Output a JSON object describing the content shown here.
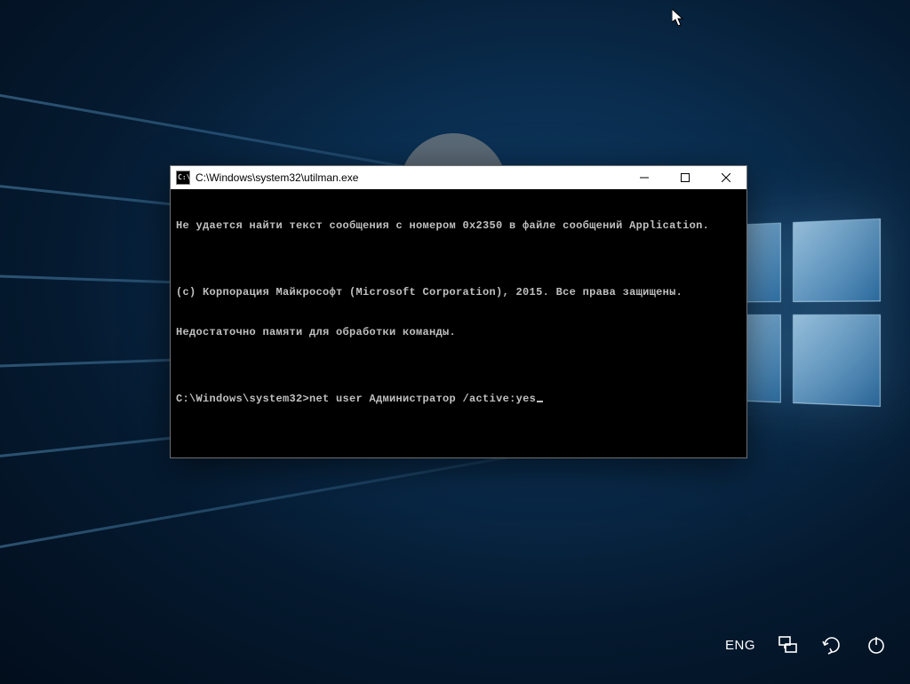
{
  "window": {
    "title": "C:\\Windows\\system32\\utilman.exe"
  },
  "terminal": {
    "lines": [
      "Не удается найти текст сообщения с номером 0x2350 в файле сообщений Application.",
      "",
      "(c) Корпорация Майкрософт (Microsoft Corporation), 2015. Все права защищены.",
      "Недостаточно памяти для обработки команды.",
      ""
    ],
    "prompt": "C:\\Windows\\system32>",
    "input": "net user Администратор /active:yes"
  },
  "login_controls": {
    "language": "ENG"
  }
}
